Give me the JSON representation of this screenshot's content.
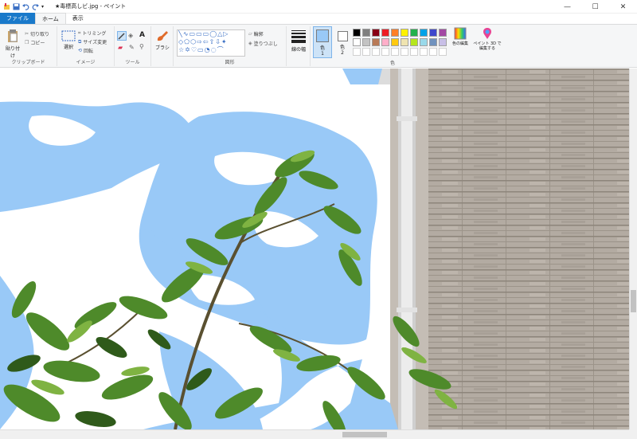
{
  "window": {
    "title": "★毒標高しビ.jpg - ペイント",
    "minimize": "—",
    "maximize": "☐",
    "close": "✕"
  },
  "tabs": [
    {
      "label": "ファイル"
    },
    {
      "label": "ホーム"
    },
    {
      "label": "表示"
    }
  ],
  "ribbon": {
    "clipboard": {
      "paste": "貼り付け",
      "cut": "切り取り",
      "copy": "コピー",
      "label": "クリップボード"
    },
    "image": {
      "select": "選択",
      "crop": "トリミング",
      "resize": "サイズ変更",
      "rotate": "回転",
      "label": "イメージ"
    },
    "tools": {
      "label": "ツール"
    },
    "brushes": {
      "label": "ブラシ"
    },
    "shapes": {
      "outline": "輪郭",
      "fill": "塗りつぶし",
      "label": "図形"
    },
    "size": {
      "label": "線の幅"
    },
    "color1": {
      "label": "色",
      "num": "1"
    },
    "color2": {
      "label": "色",
      "num": "2"
    },
    "colors": {
      "label": "色",
      "edit": "色の編集",
      "paint3d": "ペイント 3D で編集する"
    }
  },
  "palette": [
    "#000000",
    "#7f7f7f",
    "#880015",
    "#ed1c24",
    "#ff7f27",
    "#fff200",
    "#22b14c",
    "#00a2e8",
    "#3f48cc",
    "#a349a4",
    "#ffffff",
    "#c3c3c3",
    "#b97a57",
    "#ffaec9",
    "#ffc90e",
    "#efe4b0",
    "#b5e61d",
    "#99d9ea",
    "#7092be",
    "#c8bfe7"
  ],
  "colors_meta": {
    "color1": "#99c9f7",
    "color2": "#ffffff",
    "accent": "#1979ca"
  }
}
